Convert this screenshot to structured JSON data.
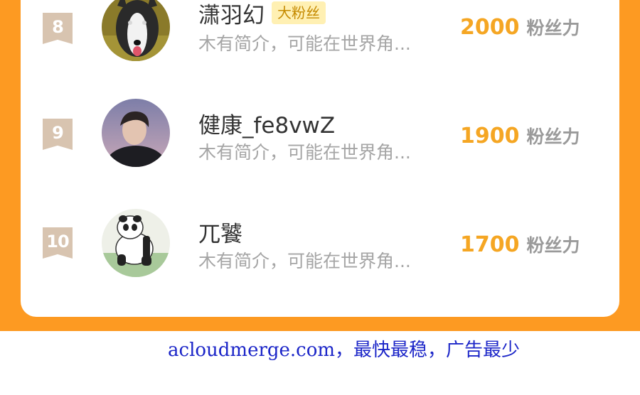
{
  "ranking": {
    "rows": [
      {
        "rank": "8",
        "name": "潇羽幻",
        "tag": "大粉丝",
        "bio": "木有简介，可能在世界角...",
        "score": "2000",
        "score_unit": "粉丝力",
        "avatar": "dog-avatar"
      },
      {
        "rank": "9",
        "name": "健康_fe8vwZ",
        "tag": "",
        "bio": "木有简介，可能在世界角...",
        "score": "1900",
        "score_unit": "粉丝力",
        "avatar": "person-avatar"
      },
      {
        "rank": "10",
        "name": "兀饕",
        "tag": "",
        "bio": "木有简介，可能在世界角...",
        "score": "1700",
        "score_unit": "粉丝力",
        "avatar": "panda-avatar"
      }
    ]
  },
  "footer": {
    "text": "acloudmerge.com，最快最稳，广告最少"
  },
  "colors": {
    "orange": "#fd9a22",
    "score": "#f5a623",
    "badge": "#d8c4b0",
    "tag_bg": "#fff0b3",
    "footer": "#1b25c8"
  }
}
